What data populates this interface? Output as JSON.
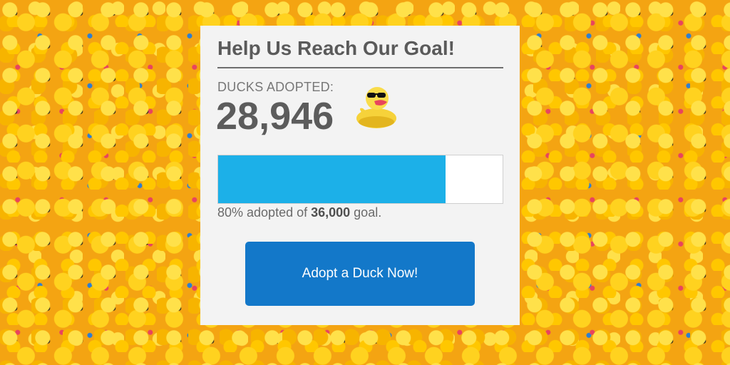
{
  "card": {
    "title": "Help Us Reach Our Goal!",
    "ducks_label": "DUCKS ADOPTED:",
    "ducks_count": "28,946",
    "progress": {
      "value": 0.8,
      "fill_color": "#1cb0e8"
    },
    "goal_text": {
      "prefix": "80% adopted of ",
      "amount": "36,000",
      "suffix": " goal."
    },
    "cta_label": "Adopt a Duck Now!",
    "cta_color": "#1378c9",
    "icon": "rubber-duck-sunglasses-icon"
  },
  "background": {
    "image": "rubber-ducks-field"
  }
}
